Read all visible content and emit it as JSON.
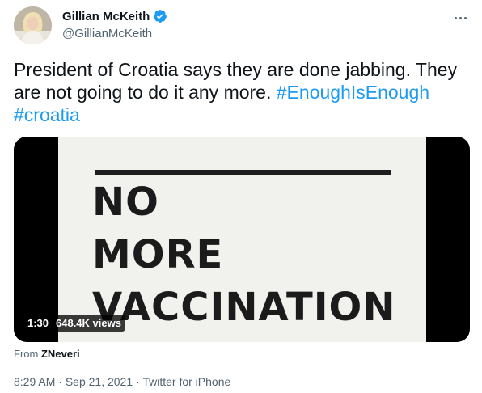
{
  "author": {
    "name": "Gillian McKeith",
    "handle": "@GillianMcKeith",
    "verified": true
  },
  "tweet": {
    "text": "President of Croatia says they are done jabbing.  They are not going to do it any more.",
    "hashtags": [
      "#EnoughIsEnough",
      "#croatia"
    ]
  },
  "media": {
    "frame_lines": [
      "NO",
      "MORE",
      "VACCINATION"
    ],
    "duration": "1:30",
    "views": "648.4K views"
  },
  "attribution": {
    "prefix": "From",
    "source": "ZNeveri"
  },
  "meta": {
    "time": "8:29 AM",
    "separator1": "·",
    "date": "Sep 21, 2021",
    "separator2": "·",
    "client": "Twitter for iPhone"
  },
  "colors": {
    "link": "#1d9bf0",
    "secondary_text": "#536471",
    "primary_text": "#0f1419",
    "verified_badge": "#1d9bf0"
  }
}
